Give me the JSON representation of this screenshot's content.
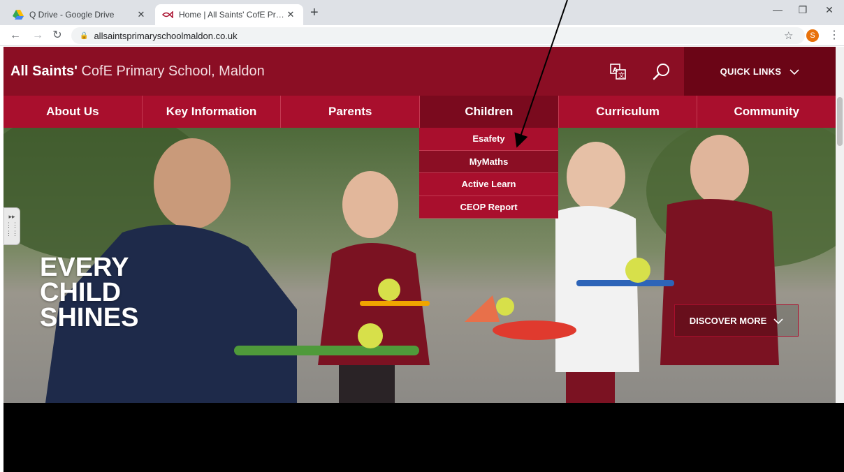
{
  "browser": {
    "tabs": [
      {
        "title": "Q Drive - Google Drive",
        "active": false
      },
      {
        "title": "Home | All Saints' CofE Primary S",
        "active": true
      }
    ],
    "new_tab": "+",
    "close_glyph": "✕",
    "url": "allsaintsprimaryschoolmaldon.co.uk",
    "profile_initial": "S"
  },
  "header": {
    "title_bold": "All Saints'",
    "title_rest": " CofE Primary School, Maldon",
    "quick_links": "QUICK LINKS",
    "translate_icon": "translate-icon",
    "search_icon": "search-icon"
  },
  "nav": {
    "items": [
      {
        "label": "About Us"
      },
      {
        "label": "Key Information"
      },
      {
        "label": "Parents"
      },
      {
        "label": "Children"
      },
      {
        "label": "Curriculum"
      },
      {
        "label": "Community"
      }
    ],
    "active_index": 3
  },
  "dropdown": {
    "items": [
      {
        "label": "Esafety"
      },
      {
        "label": "MyMaths"
      },
      {
        "label": "Active Learn"
      },
      {
        "label": "CEOP Report"
      }
    ],
    "hover_index": 1
  },
  "hero": {
    "lines": [
      "EVERY",
      "CHILD",
      "SHINES"
    ],
    "cta": "DISCOVER MORE"
  },
  "colors": {
    "header": "#8b0e24",
    "nav": "#a90f2d",
    "quick_links": "#6b0516",
    "accent": "#a90f2d"
  }
}
